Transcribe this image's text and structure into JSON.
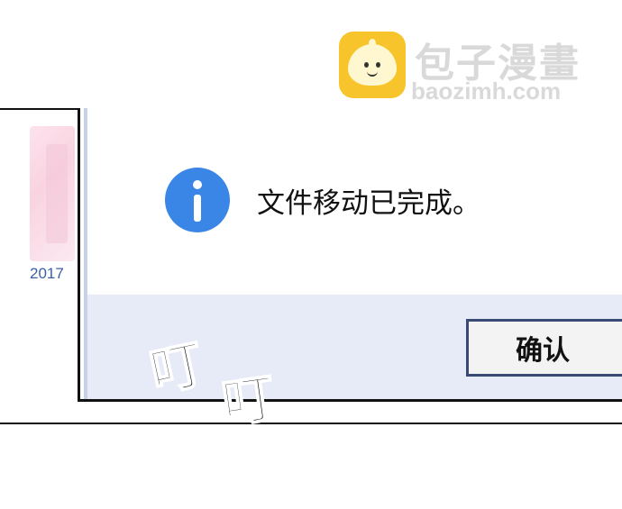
{
  "watermark": {
    "logo_icon": "baozi-bun-icon",
    "title": "包子漫畫",
    "url": "baozimh.com"
  },
  "explorer": {
    "folder_label": "2017"
  },
  "dialog": {
    "icon": "info-icon",
    "message": "文件移动已完成。",
    "ok_label": "确认"
  },
  "sfx": {
    "first": "叮",
    "second": "叮"
  },
  "colors": {
    "info_icon": "#3a86e6",
    "footer_bg": "#e6ebf7",
    "button_border": "#3a4a74",
    "watermark_logo": "#f7c52b"
  }
}
